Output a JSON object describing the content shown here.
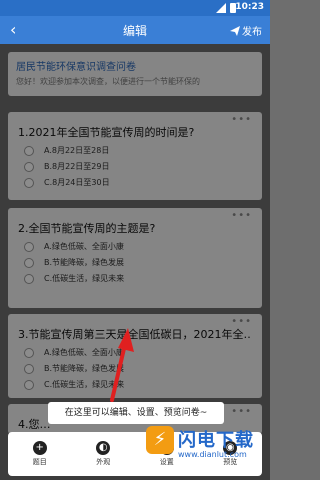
{
  "status_bar": {
    "time": "10:23"
  },
  "top_bar": {
    "back": "‹",
    "title": "编辑",
    "publish": "发布"
  },
  "survey": {
    "title": "居民节能环保意识调查问卷",
    "description": "您好！欢迎参加本次调查，以便进行一个节能环保的"
  },
  "questions": [
    {
      "title": "1.2021年全国节能宣传周的时间是?",
      "options": [
        "A.8月22日至28日",
        "B.8月22日至29日",
        "C.8月24日至30日"
      ]
    },
    {
      "title": "2.全国节能宣传周的主题是?",
      "options": [
        "A.绿色低碳、全面小康",
        "B.节能降碳，绿色发展",
        "C.低碳生活，绿见未来"
      ]
    },
    {
      "title": "3.节能宣传周第三天是全国低碳日，2021年全…",
      "options": [
        "A.绿色低碳、全面小康",
        "B.节能降碳，绿色发展",
        "C.低碳生活，绿见未来"
      ]
    },
    {
      "title": "4.您…",
      "options": []
    }
  ],
  "more_label": "•••",
  "tooltip": "在这里可以编辑、设置、预览问卷~",
  "bottom_nav": [
    {
      "label": "题目",
      "icon": "plus-icon",
      "glyph": "+"
    },
    {
      "label": "外观",
      "icon": "palette-icon",
      "glyph": "◐"
    },
    {
      "label": "设置",
      "icon": "gear-icon",
      "glyph": "✱"
    },
    {
      "label": "预览",
      "icon": "eye-icon",
      "glyph": "◉"
    }
  ],
  "watermark": {
    "text": "闪电下载",
    "url": "www.dianlut.com",
    "logo": "⚡"
  },
  "colors": {
    "primary": "#3a7fd6",
    "link": "#2a66b8",
    "arrow": "#e02020"
  }
}
